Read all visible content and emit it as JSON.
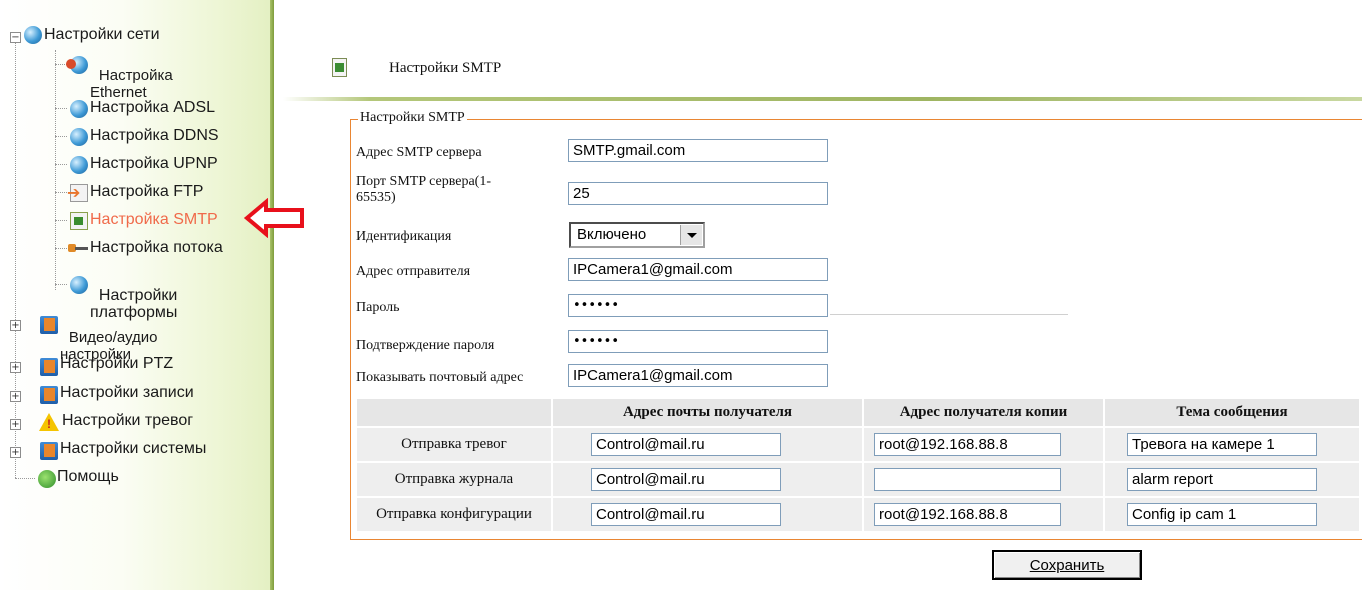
{
  "sidebar": {
    "network": {
      "label": "Настройки сети",
      "items": {
        "ethernet": "Настройка\nEthernet",
        "adsl": "Настройка ADSL",
        "ddns": "Настройка DDNS",
        "upnp": "Настройка UPNP",
        "ftp": "Настройка FTP",
        "smtp": "Настройка SMTP",
        "stream": "Настройка потока",
        "platform": "Настройки\nплатформы"
      }
    },
    "video_audio": "Видео/аудио\nнастройки",
    "ptz": "Настройки PTZ",
    "record": "Настройки записи",
    "alarm": "Настройки тревог",
    "system": "Настройки системы",
    "help": "Помощь",
    "active_item": "smtp",
    "colors": {
      "active_text": "#f06a4a",
      "pointer_arrow": "#e8101b",
      "border_green": "#8aa84a"
    }
  },
  "header": {
    "title": "Настройки SMTP"
  },
  "form": {
    "legend": "Настройки SMTP",
    "smtp_server_label": "Адрес SMTP сервера",
    "smtp_server_value": "SMTP.gmail.com",
    "smtp_port_label": "Порт SMTP сервера(1-\n65535)",
    "smtp_port_value": "25",
    "auth_label": "Идентификация",
    "auth_value": "Включено",
    "sender_label": "Адрес отправителя",
    "sender_value": "IPCamera1@gmail.com",
    "password_label": "Пароль",
    "password_value": "••••••",
    "password_confirm_label": "Подтверждение пароля",
    "password_confirm_value": "••••••",
    "show_address_label": "Показывать почтовый адрес",
    "show_address_value": "IPCamera1@gmail.com",
    "accent_color": "#e98633"
  },
  "recipients": {
    "headers": [
      "",
      "Адрес почты получателя",
      "Адрес получателя копии",
      "Тема сообщения"
    ],
    "rows": [
      {
        "label": "Отправка тревог",
        "to": "Control@mail.ru",
        "cc": "root@192.168.88.8",
        "subject": "Тревога на камере 1"
      },
      {
        "label": "Отправка журнала",
        "to": "Control@mail.ru",
        "cc": "",
        "subject": "alarm report"
      },
      {
        "label": "Отправка конфигурации",
        "to": "Control@mail.ru",
        "cc": "root@192.168.88.8",
        "subject": "Config ip cam 1"
      }
    ]
  },
  "save_label": "Сохранить"
}
